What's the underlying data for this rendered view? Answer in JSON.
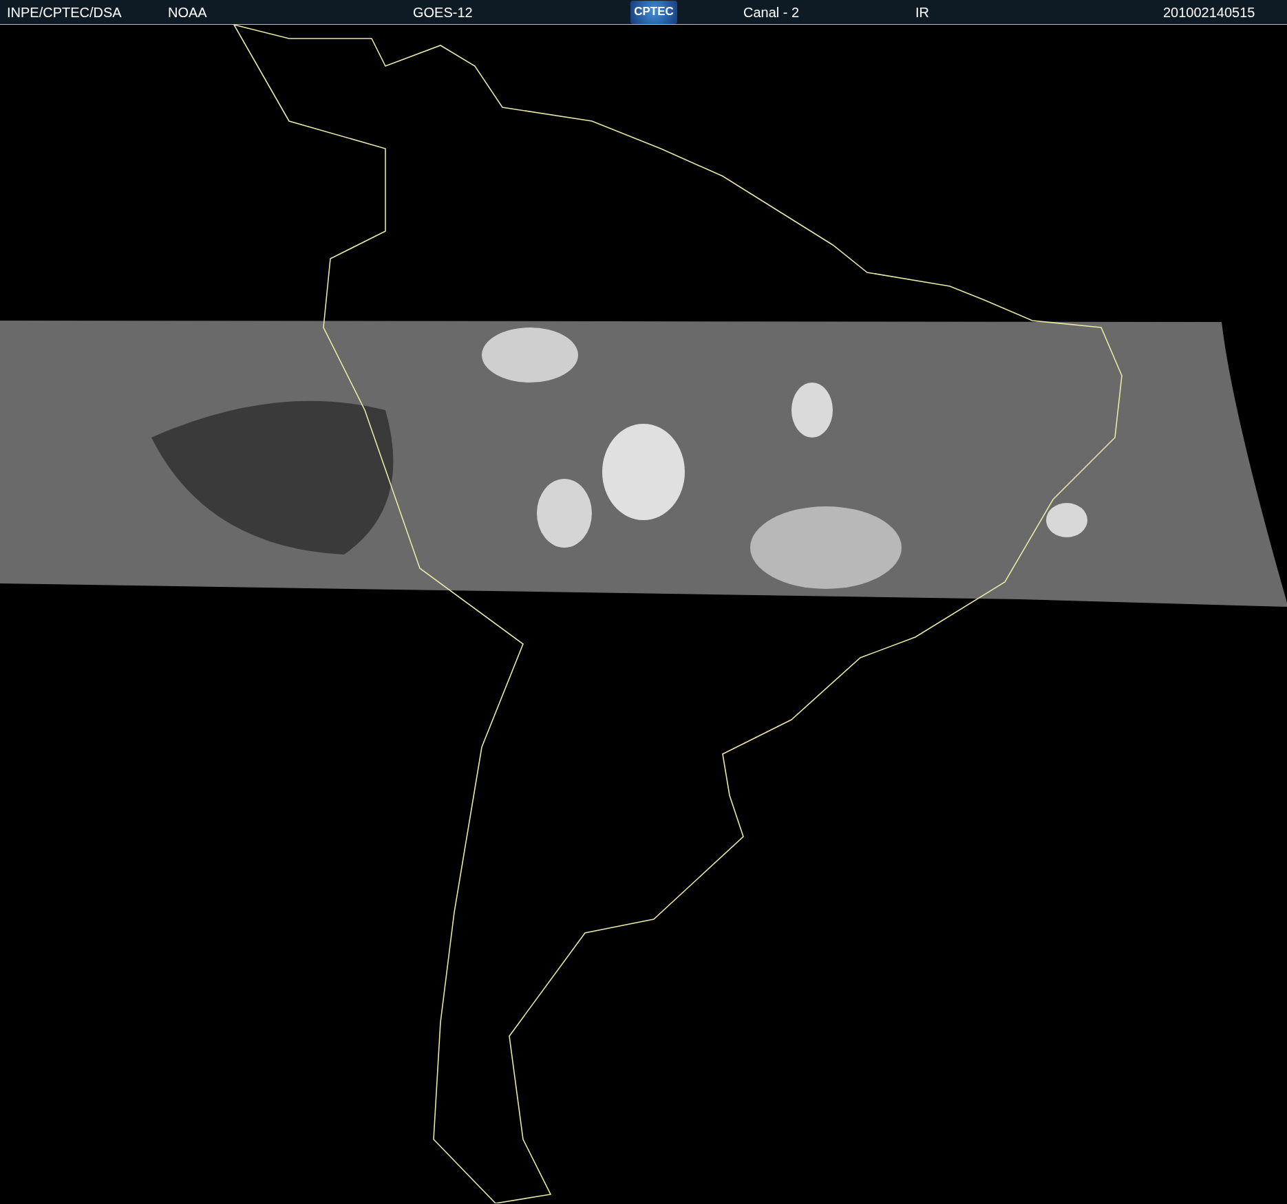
{
  "header": {
    "source": "INPE/CPTEC/DSA",
    "agency": "NOAA",
    "satellite": "GOES-12",
    "logo_text": "CPTEC",
    "channel": "Canal - 2",
    "band": "IR",
    "timestamp": "201002140515"
  }
}
